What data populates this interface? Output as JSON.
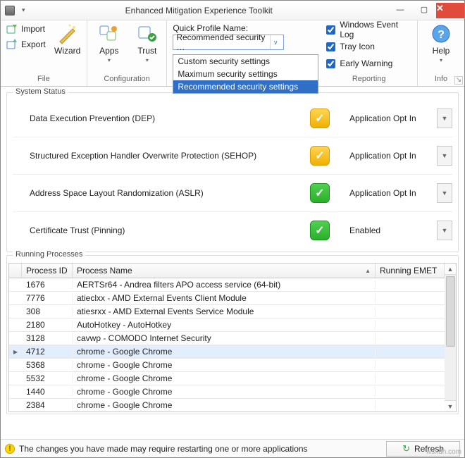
{
  "window": {
    "title": "Enhanced Mitigation Experience Toolkit"
  },
  "ribbon": {
    "file": {
      "group_label": "File",
      "import_label": "Import",
      "export_label": "Export",
      "wizard_label": "Wizard"
    },
    "configuration": {
      "group_label": "Configuration",
      "apps_label": "Apps",
      "trust_label": "Trust"
    },
    "quick_profile": {
      "label": "Quick Profile Name:",
      "selected_display": "Recommended security …",
      "options": [
        "Custom security settings",
        "Maximum security settings",
        "Recommended security settings"
      ]
    },
    "reporting": {
      "group_label": "Reporting",
      "event_log": "Windows Event Log",
      "tray_icon": "Tray Icon",
      "early_warning": "Early Warning"
    },
    "info": {
      "group_label": "Info",
      "help_label": "Help"
    }
  },
  "system_status": {
    "legend": "System Status",
    "rows": [
      {
        "name": "Data Execution Prevention (DEP)",
        "icon": "yellow",
        "value": "Application Opt In"
      },
      {
        "name": "Structured Exception Handler Overwrite Protection (SEHOP)",
        "icon": "yellow",
        "value": "Application Opt In"
      },
      {
        "name": "Address Space Layout Randomization (ASLR)",
        "icon": "green",
        "value": "Application Opt In"
      },
      {
        "name": "Certificate Trust (Pinning)",
        "icon": "green",
        "value": "Enabled"
      }
    ]
  },
  "running_processes": {
    "legend": "Running Processes",
    "columns": {
      "pid": "Process ID",
      "pname": "Process Name",
      "remet": "Running EMET"
    },
    "selected_index": 5,
    "rows": [
      {
        "pid": "1676",
        "pname": "AERTSr64 - Andrea filters APO access service (64-bit)"
      },
      {
        "pid": "7776",
        "pname": "atieclxx - AMD External Events Client Module"
      },
      {
        "pid": "308",
        "pname": "atiesrxx - AMD External Events Service Module"
      },
      {
        "pid": "2180",
        "pname": "AutoHotkey - AutoHotkey"
      },
      {
        "pid": "3128",
        "pname": "cavwp - COMODO Internet Security"
      },
      {
        "pid": "4712",
        "pname": "chrome - Google Chrome"
      },
      {
        "pid": "5368",
        "pname": "chrome - Google Chrome"
      },
      {
        "pid": "5532",
        "pname": "chrome - Google Chrome"
      },
      {
        "pid": "1440",
        "pname": "chrome - Google Chrome"
      },
      {
        "pid": "2384",
        "pname": "chrome - Google Chrome"
      }
    ]
  },
  "statusbar": {
    "message": "The changes you have made may require restarting one or more applications",
    "refresh_label": "Refresh"
  },
  "watermark": "wsxdn.com"
}
